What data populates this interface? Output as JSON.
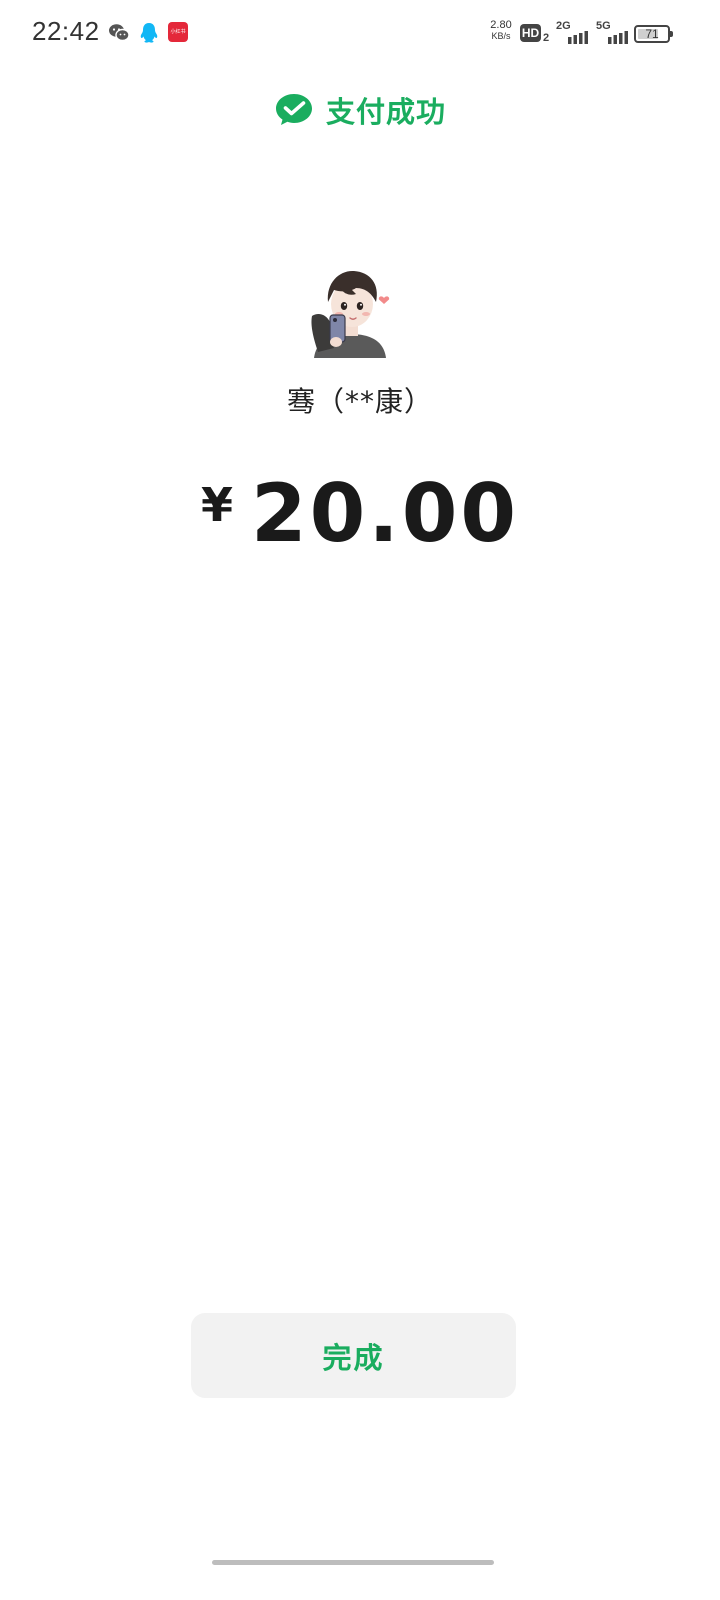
{
  "status_bar": {
    "time": "22:42",
    "notification_icons": [
      "wechat-icon",
      "qq-icon",
      "red-app-icon"
    ],
    "red_app_label": "小红书",
    "net_speed_value": "2.80",
    "net_speed_unit": "KB/s",
    "hd_label": "HD",
    "hd_sub": "2",
    "signal_1_label": "2G",
    "signal_2_label": "5G",
    "battery_level": "71"
  },
  "header": {
    "title": "支付成功",
    "icon": "wechat-pay-icon",
    "accent_color": "#1aad5f"
  },
  "payee": {
    "name": "骞（**康）",
    "avatar": "avatar-cartoon-boy-selfie"
  },
  "amount": {
    "currency_symbol": "¥",
    "value": "20.00"
  },
  "done_button": {
    "label": "完成"
  }
}
